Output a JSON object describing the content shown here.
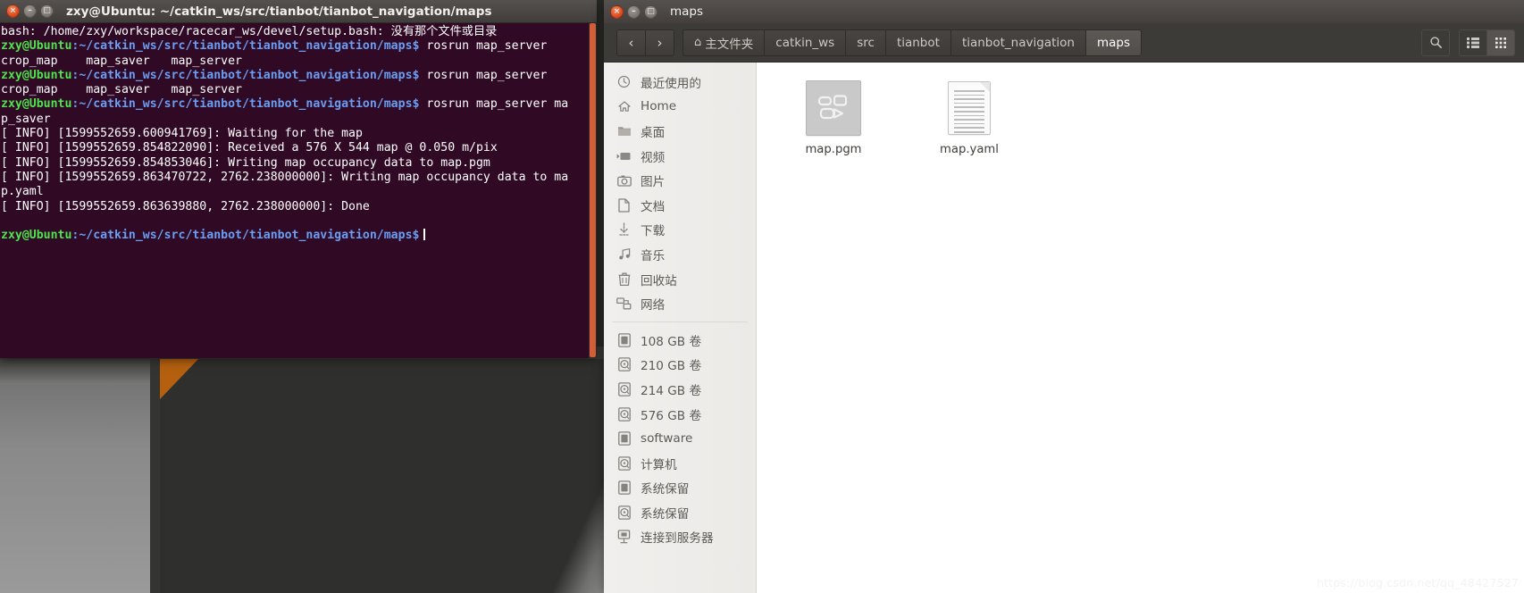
{
  "desktop": {
    "background_app": "rviz-viewport"
  },
  "terminal": {
    "title": "zxy@Ubuntu: ~/catkin_ws/src/tianbot/tianbot_navigation/maps",
    "window_controls": {
      "close": "×",
      "minimize": "–",
      "maximize": "□"
    },
    "prompt_user": "zxy@Ubuntu",
    "prompt_path": ":~/catkin_ws/src/tianbot/tianbot_navigation/maps$",
    "lines": [
      {
        "type": "plain",
        "text": "bash: /home/zxy/workspace/racecar_ws/devel/setup.bash: 没有那个文件或目录"
      },
      {
        "type": "prompt",
        "command": " rosrun map_server"
      },
      {
        "type": "plain",
        "text": "crop_map    map_saver   map_server"
      },
      {
        "type": "prompt",
        "command": " rosrun map_server"
      },
      {
        "type": "plain",
        "text": "crop_map    map_saver   map_server"
      },
      {
        "type": "prompt",
        "command": " rosrun map_server ma"
      },
      {
        "type": "plain",
        "text": "p_saver"
      },
      {
        "type": "plain",
        "text": "[ INFO] [1599552659.600941769]: Waiting for the map"
      },
      {
        "type": "plain",
        "text": "[ INFO] [1599552659.854822090]: Received a 576 X 544 map @ 0.050 m/pix"
      },
      {
        "type": "plain",
        "text": "[ INFO] [1599552659.854853046]: Writing map occupancy data to map.pgm"
      },
      {
        "type": "plain",
        "text": "[ INFO] [1599552659.863470722, 2762.238000000]: Writing map occupancy data to ma"
      },
      {
        "type": "plain",
        "text": "p.yaml"
      },
      {
        "type": "plain",
        "text": "[ INFO] [1599552659.863639880, 2762.238000000]: Done"
      },
      {
        "type": "plain",
        "text": ""
      },
      {
        "type": "prompt",
        "command": ""
      }
    ]
  },
  "files": {
    "title": "maps",
    "window_controls": {
      "close": "×",
      "minimize": "–",
      "maximize": "□"
    },
    "nav": {
      "back": "‹",
      "forward": "›"
    },
    "breadcrumbs": [
      {
        "label": "主文件夹",
        "icon": "home-icon",
        "active": false
      },
      {
        "label": "catkin_ws",
        "active": false
      },
      {
        "label": "src",
        "active": false
      },
      {
        "label": "tianbot",
        "active": false
      },
      {
        "label": "tianbot_navigation",
        "active": false
      },
      {
        "label": "maps",
        "active": true
      }
    ],
    "toolbar_right": {
      "search": "search-icon",
      "list_view": "list-view-icon",
      "grid_view": "grid-view-icon",
      "active_view": "grid_view"
    },
    "sidebar": {
      "groups": [
        {
          "items": [
            {
              "label": "最近使用的",
              "icon": "clock-icon"
            },
            {
              "label": "Home",
              "icon": "home-icon"
            },
            {
              "label": "桌面",
              "icon": "folder-icon"
            },
            {
              "label": "视频",
              "icon": "video-icon"
            },
            {
              "label": "图片",
              "icon": "camera-icon"
            },
            {
              "label": "文档",
              "icon": "document-icon"
            },
            {
              "label": "下载",
              "icon": "download-icon"
            },
            {
              "label": "音乐",
              "icon": "music-icon"
            },
            {
              "label": "回收站",
              "icon": "trash-icon"
            },
            {
              "label": "网络",
              "icon": "network-icon"
            }
          ]
        },
        {
          "items": [
            {
              "label": "108 GB 卷",
              "icon": "drive-icon"
            },
            {
              "label": "210 GB 卷",
              "icon": "disk-icon"
            },
            {
              "label": "214 GB 卷",
              "icon": "disk-icon"
            },
            {
              "label": "576 GB 卷",
              "icon": "disk-icon"
            },
            {
              "label": "software",
              "icon": "drive-icon"
            },
            {
              "label": "计算机",
              "icon": "disk-icon"
            },
            {
              "label": "系统保留",
              "icon": "drive-icon"
            },
            {
              "label": "系统保留",
              "icon": "disk-icon"
            },
            {
              "label": "连接到服务器",
              "icon": "server-icon"
            }
          ]
        }
      ]
    },
    "content": {
      "items": [
        {
          "name": "map.pgm",
          "icon": "image-thumbnail"
        },
        {
          "name": "map.yaml",
          "icon": "text-document"
        }
      ]
    }
  },
  "watermark": {
    "text": "https://blog.csdn.net/qq_48427527"
  }
}
